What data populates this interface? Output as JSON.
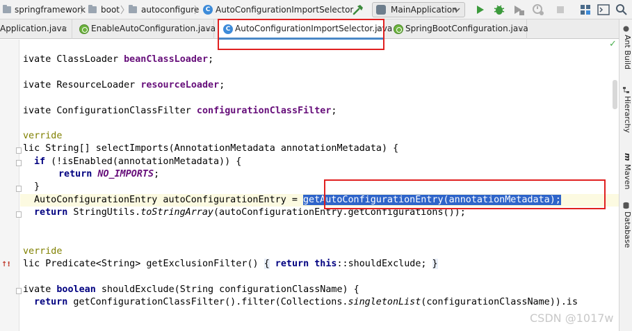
{
  "breadcrumb": {
    "items": [
      "springframework",
      "boot",
      "autoconfigure",
      "AutoConfigurationImportSelector"
    ],
    "class_icon_letter": "C"
  },
  "toolbar": {
    "run_config": "MainApplication"
  },
  "tabs": [
    {
      "label": "Application.java",
      "active": false
    },
    {
      "label": "EnableAutoConfiguration.java",
      "active": false
    },
    {
      "label": "AutoConfigurationImportSelector.java",
      "active": true
    },
    {
      "label": "SpringBootConfiguration.java",
      "active": false
    }
  ],
  "tab_close_glyph": "×",
  "code": {
    "l1": {
      "pre": "ivate ClassLoader ",
      "field": "beanClassLoader",
      "post": ";"
    },
    "l2": {
      "pre": "ivate ResourceLoader ",
      "field": "resourceLoader",
      "post": ";"
    },
    "l3": {
      "pre": "ivate ConfigurationClassFilter ",
      "field": "configurationClassFilter",
      "post": ";"
    },
    "l4": {
      "annot": "verride"
    },
    "l5": {
      "text": "lic String[] selectImports(AnnotationMetadata annotationMetadata) {"
    },
    "l6": {
      "kw": "if",
      "post": " (!isEnabled(annotationMetadata)) {"
    },
    "l7": {
      "kw": "return",
      "field": "NO_IMPORTS",
      "post": ";"
    },
    "l8": {
      "text": "}"
    },
    "l9": {
      "pre": "AutoConfigurationEntry autoConfigurationEntry = ",
      "sel": "getAutoConfigurationEntry(annotationMetadata);"
    },
    "l10": {
      "kw": "return",
      "pre": " StringUtils.",
      "ital": "toStringArray",
      "post": "(autoConfigurationEntry.getConfigurations());"
    },
    "l11": {
      "annot": "verride"
    },
    "l12": {
      "pre": "lic Predicate<String> getExclusionFilter() ",
      "b1": "{",
      "kw1": "return",
      "kw2": "this",
      "post": "::shouldExclude; ",
      "b2": "}"
    },
    "l13": {
      "kw1": "ivate",
      "kw2": "boolean",
      "post": " shouldExclude(String configurationClassName) {"
    },
    "l14": {
      "kw": "return",
      "pre": " getConfigurationClassFilter().filter(Collections.",
      "ital": "singletonList",
      "post": "(configurationClassName)).is"
    }
  },
  "side_tools": [
    "Ant Build",
    "Hierarchy",
    "Maven",
    "Database"
  ],
  "watermark": "CSDN @1017w",
  "colors": {
    "keyword": "#000080",
    "field": "#660e7a",
    "annotation": "#808000",
    "selection": "#2f65ca",
    "highlight_box": "#e02020"
  }
}
